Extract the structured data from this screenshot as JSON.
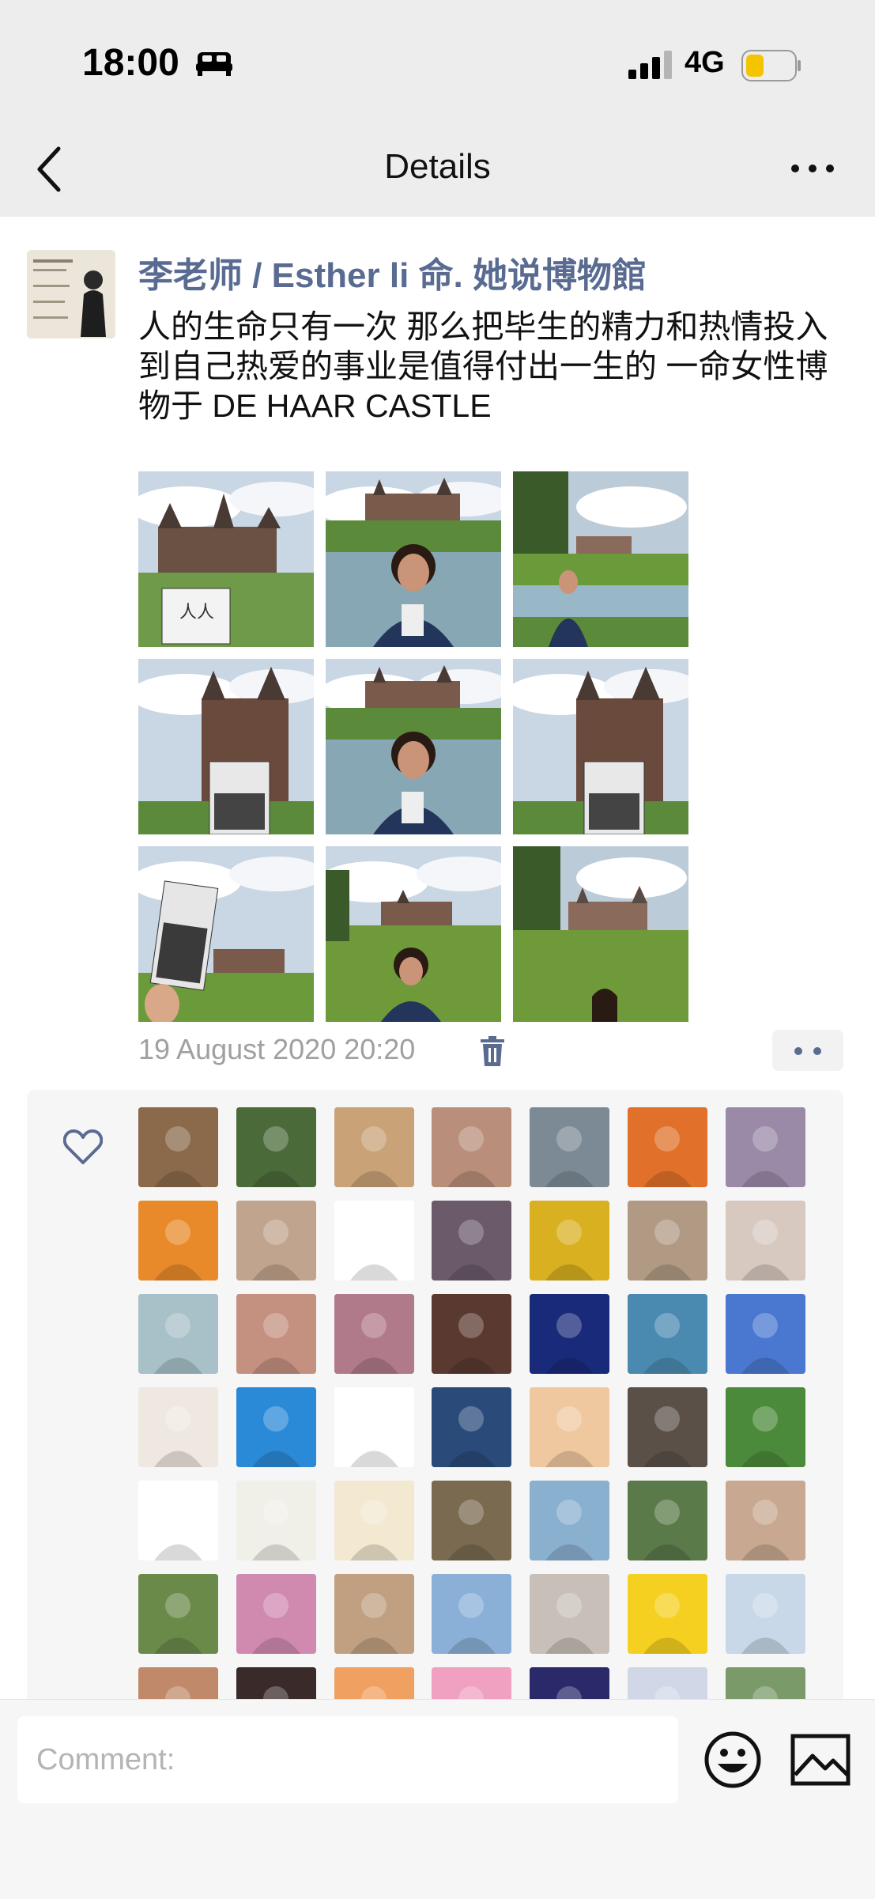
{
  "status_bar": {
    "time": "18:00",
    "network": "4G",
    "icons": [
      "bed-icon",
      "signal-icon",
      "battery-icon"
    ]
  },
  "nav": {
    "title": "Details",
    "icons": [
      "back-chevron-icon",
      "more-icon"
    ]
  },
  "post": {
    "author": "李老师 / Esther li 命. 她说博物館",
    "text": "人的生命只有一次  那么把毕生的精力和热情投入到自己热爱的事业是值得付出一生的  一命女性博物于 DE HAAR CASTLE",
    "photos": [
      {
        "scene": "castle-with-book"
      },
      {
        "scene": "woman-castle-pond"
      },
      {
        "scene": "woman-far-castle"
      },
      {
        "scene": "tower-with-book"
      },
      {
        "scene": "woman-castle-pond"
      },
      {
        "scene": "tower-with-book"
      },
      {
        "scene": "book-held-sky"
      },
      {
        "scene": "woman-castle-grass"
      },
      {
        "scene": "woman-castle-grass-right"
      }
    ],
    "timestamp": "19 August 2020 20:20"
  },
  "likes": {
    "icon": "heart-icon",
    "avatar_colors": [
      [
        "#8a6a4a",
        "#4a6a3a",
        "#c9a277",
        "#b98e7a",
        "#7c8a96",
        "#e0702a",
        "#9a8aa8"
      ],
      [
        "#e98a2a",
        "#c0a48e",
        "#ffffff",
        "#6a5a6a",
        "#d8b020",
        "#b09a84",
        "#d7c8c0"
      ],
      [
        "#a8c0c8",
        "#c49080",
        "#b07a8a",
        "#5a3a30",
        "#1a2a7a",
        "#4a8ab0",
        "#4a78d0"
      ],
      [
        "#efe8e0",
        "#2a8ad8",
        "#ffffff",
        "#2a4a7a",
        "#f0c8a0",
        "#5a5048",
        "#4a8a3a"
      ],
      [
        "#ffffff",
        "#f0efe8",
        "#f3e8d0",
        "#7a6a50",
        "#8ab0d0",
        "#5a7a4a",
        "#c8a890"
      ],
      [
        "#6a8a4a",
        "#d08ab0",
        "#c0a080",
        "#8ab0d8",
        "#c8c0b8",
        "#f5d020",
        "#c8d8e8"
      ],
      [
        "#c08a6a",
        "#3a2a2a",
        "#f0a060",
        "#f0a0c0",
        "#2a2a6a",
        "#d0d8e8",
        "#7a9a6a"
      ]
    ]
  },
  "comment": {
    "placeholder": "Comment:",
    "icons": [
      "emoji-icon",
      "image-icon"
    ]
  }
}
